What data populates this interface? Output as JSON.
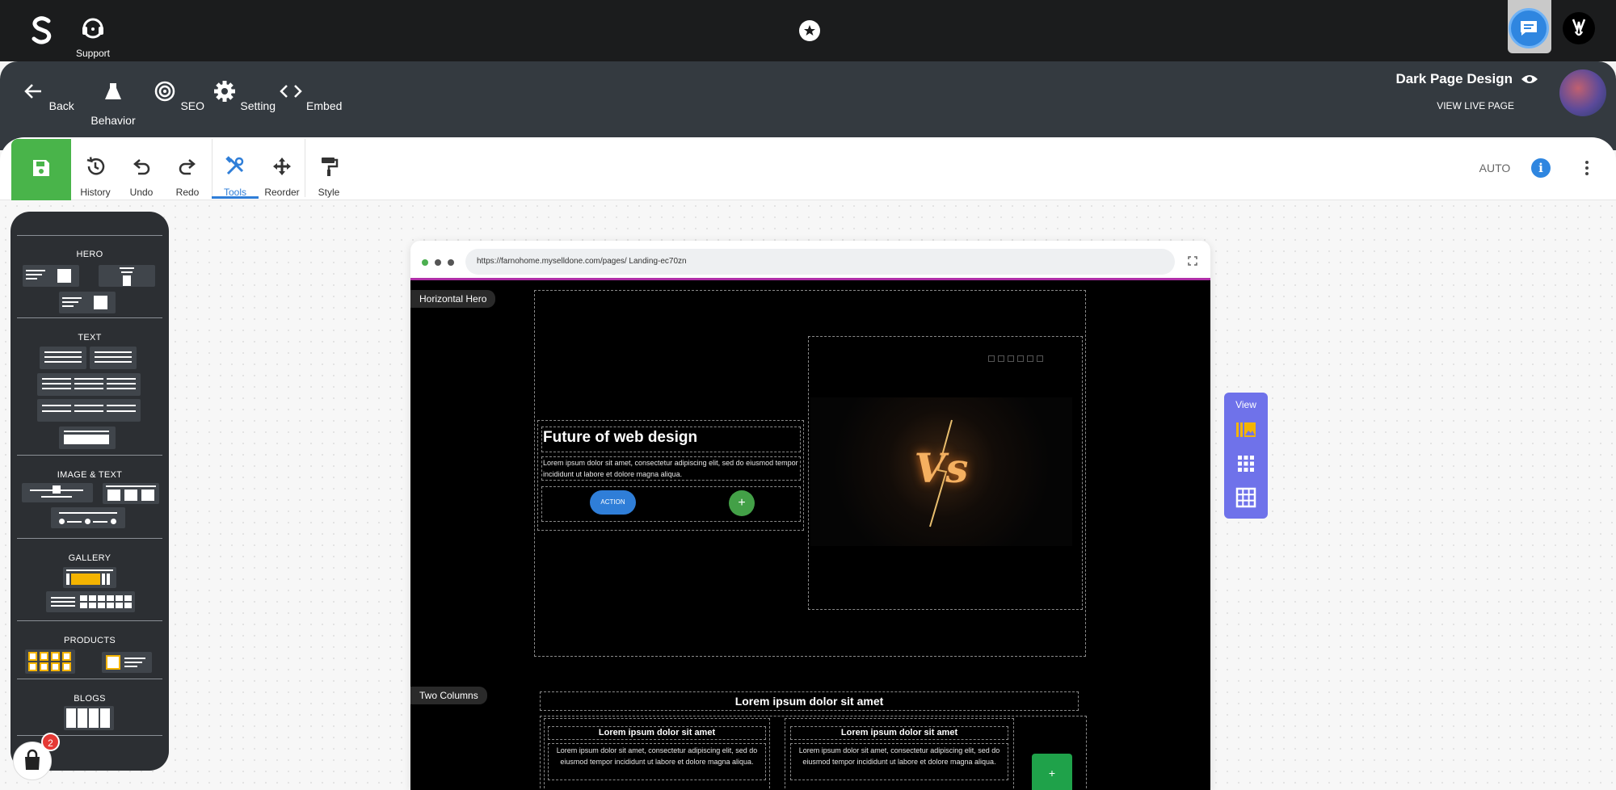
{
  "topbar": {
    "support_label": "Support"
  },
  "nav": {
    "items": [
      {
        "label": "Back",
        "icon": "arrow-left-icon"
      },
      {
        "label": "Behavior",
        "icon": "flask-icon"
      },
      {
        "label": "SEO",
        "icon": "target-icon"
      },
      {
        "label": "Setting",
        "icon": "gear-icon"
      },
      {
        "label": "Embed",
        "icon": "code-icon"
      }
    ],
    "page_title": "Dark Page Design",
    "view_live": "VIEW LIVE PAGE"
  },
  "toolbar": {
    "items": [
      {
        "label": "History"
      },
      {
        "label": "Undo"
      },
      {
        "label": "Redo"
      },
      {
        "label": "Tools"
      },
      {
        "label": "Reorder"
      },
      {
        "label": "Style"
      }
    ],
    "auto_label": "AUTO",
    "info_label": "i"
  },
  "sidebar": {
    "sections": [
      "HERO",
      "TEXT",
      "IMAGE & TEXT",
      "GALLERY",
      "PRODUCTS",
      "BLOGS"
    ],
    "cart_count": "2"
  },
  "browser": {
    "url": "https://farnohome.myselldone.com/pages/ Landing-ec70zn"
  },
  "hero": {
    "tag": "Horizontal Hero",
    "title": "Future of web design",
    "text": "Lorem ipsum dolor sit amet, consectetur adipiscing elit, sed do eiusmod tempor incididunt ut labore et dolore magna aliqua.",
    "action": "ACTION",
    "plus": "+",
    "media_text": "Vs"
  },
  "two_columns": {
    "tag": "Two Columns",
    "title": "Lorem ipsum dolor sit amet",
    "columns": [
      {
        "heading": "Lorem ipsum dolor sit amet",
        "text": "Lorem ipsum dolor sit amet, consectetur adipiscing elit, sed do eiusmod tempor incididunt ut labore et dolore magna aliqua."
      },
      {
        "heading": "Lorem ipsum dolor sit amet",
        "text": "Lorem ipsum dolor sit amet, consectetur adipiscing elit, sed do eiusmod tempor incididunt ut labore et dolore magna aliqua."
      }
    ],
    "plus": "+"
  },
  "view_panel": {
    "label": "View"
  },
  "colors": {
    "accent": "#2f7ed8",
    "save_green": "#49b44a",
    "view_purple": "#6f72ea",
    "dark_bar": "#343a40"
  }
}
